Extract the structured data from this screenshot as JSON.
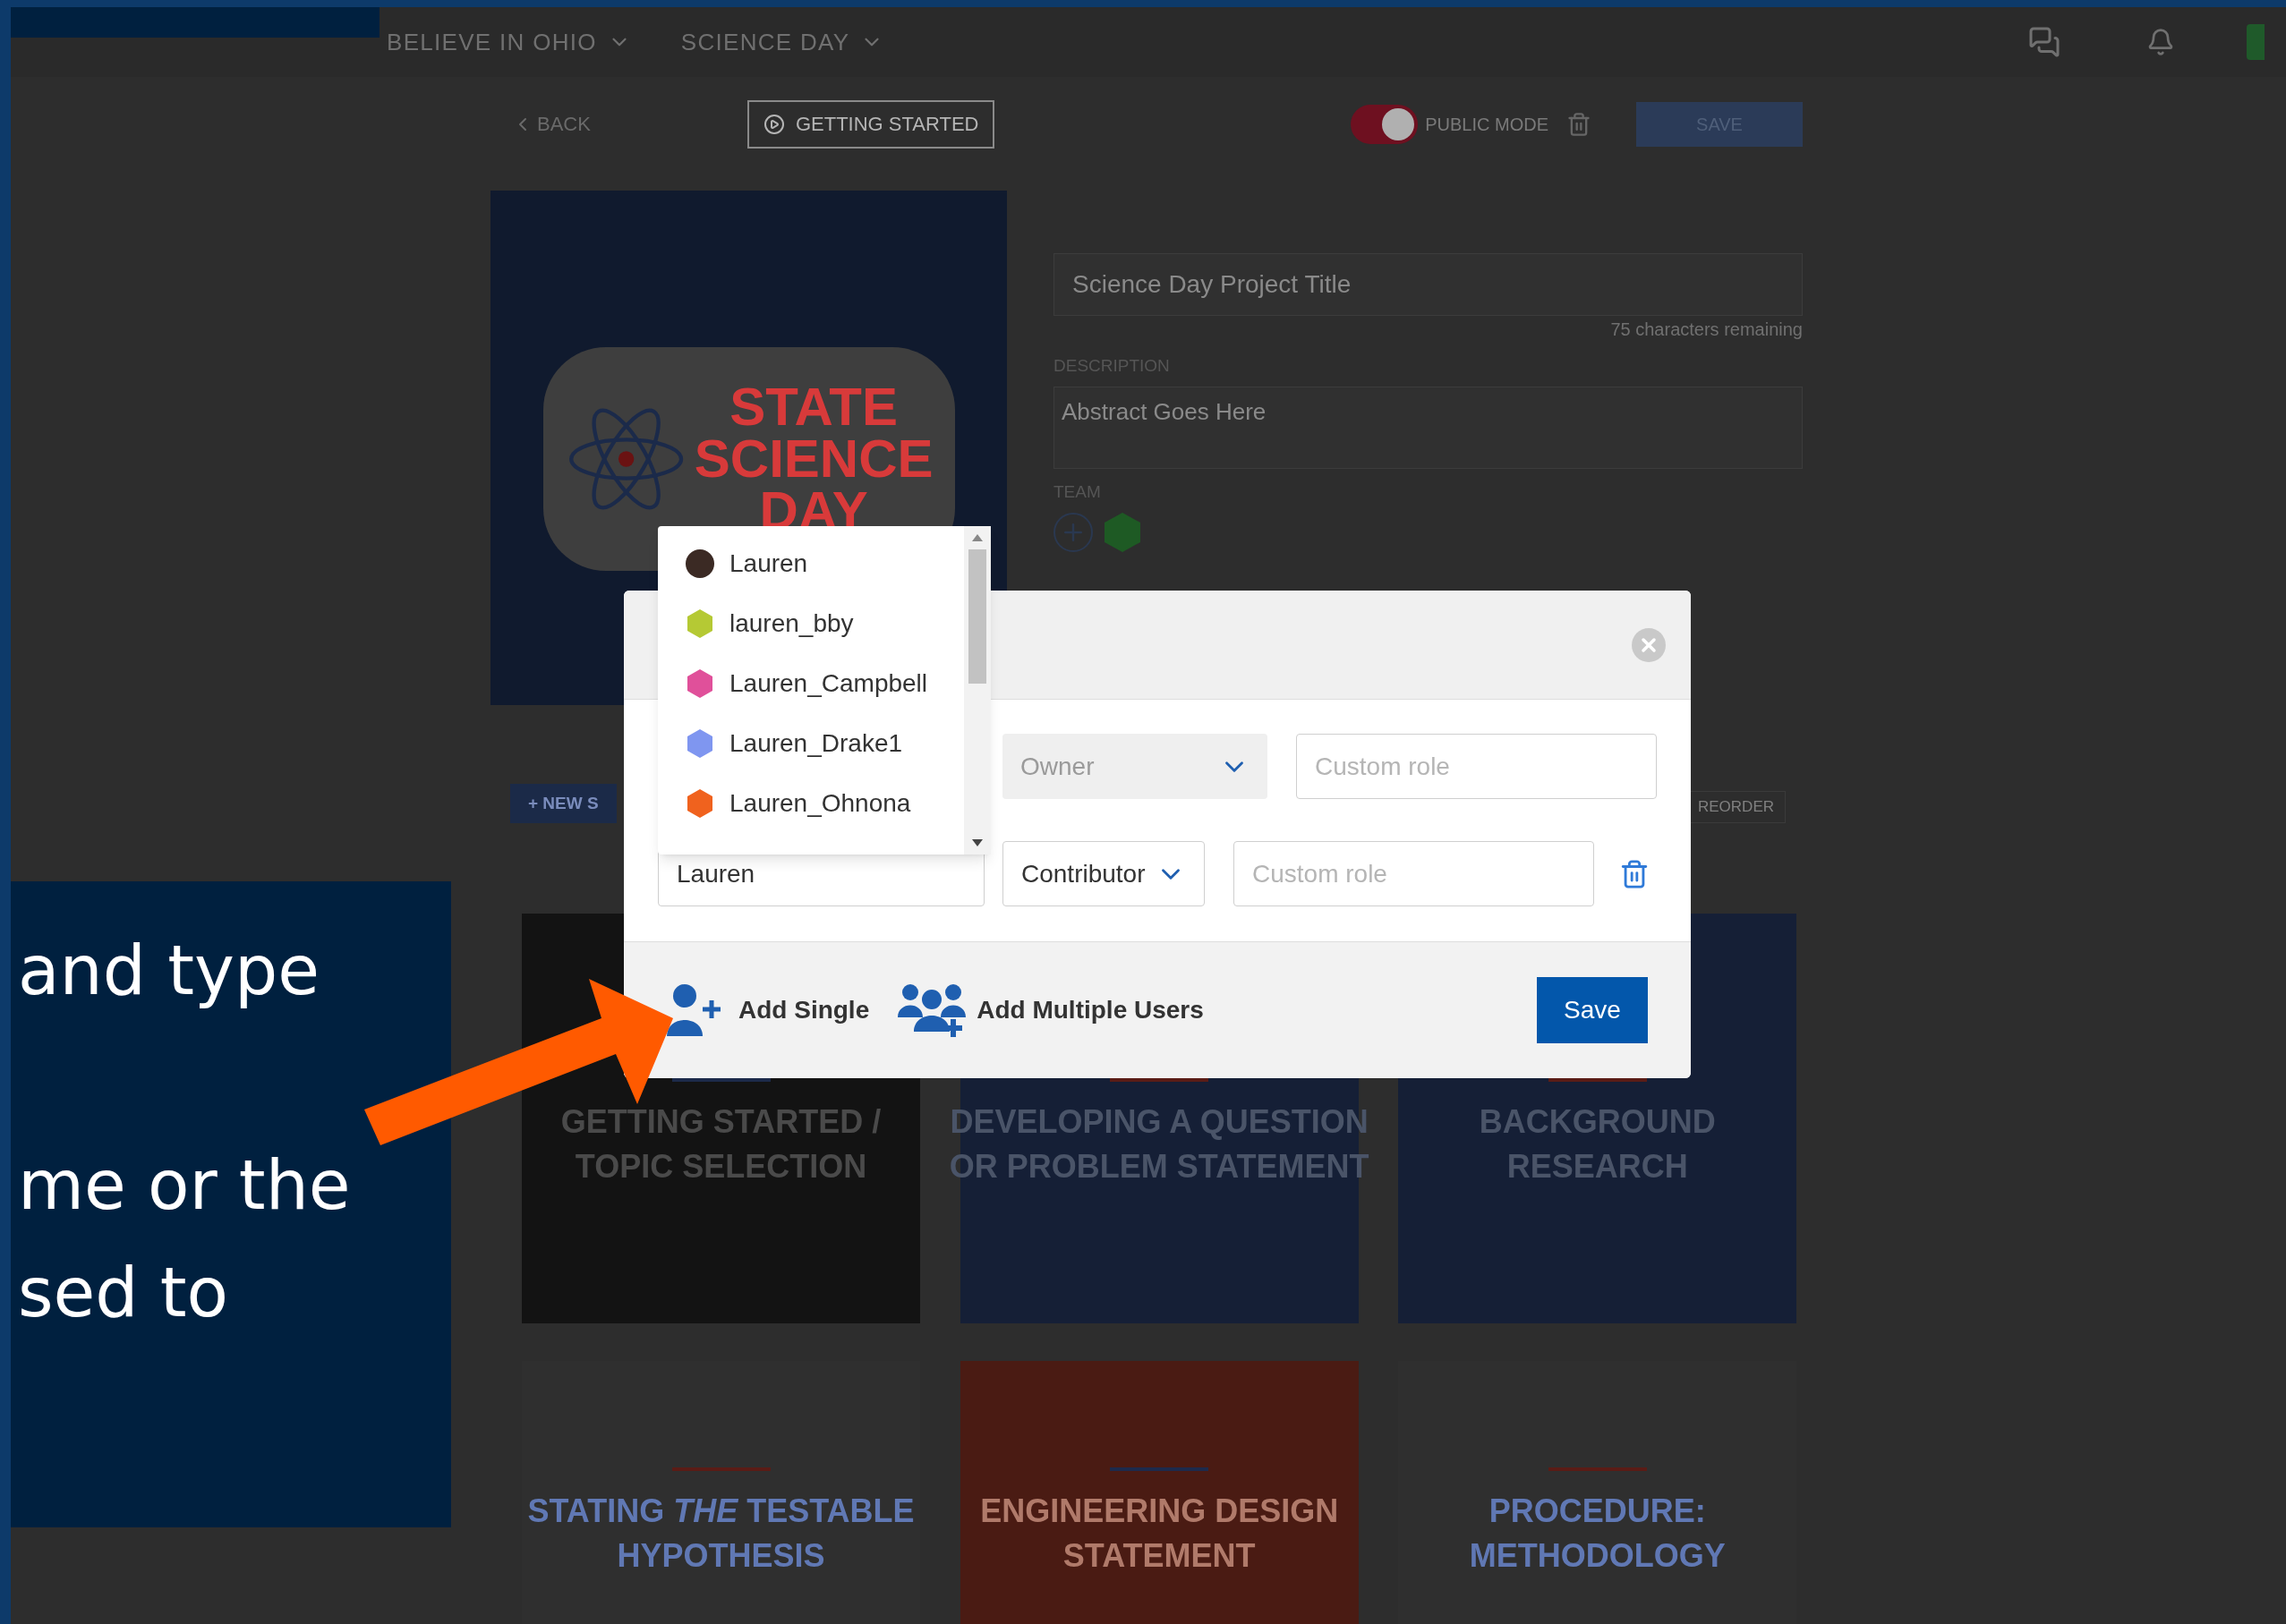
{
  "nav": {
    "items": [
      {
        "label": "BELIEVE IN OHIO"
      },
      {
        "label": "SCIENCE DAY"
      }
    ]
  },
  "toolbar": {
    "back": "BACK",
    "getting_started": "GETTING STARTED",
    "public_mode": {
      "label": "PUBLIC MODE",
      "on": true
    },
    "save": "SAVE"
  },
  "project": {
    "logo_lines": [
      "STATE",
      "SCIENCE",
      "DAY"
    ],
    "title": {
      "value": "Science Day Project Title",
      "counter": "75 characters remaining"
    },
    "description": {
      "label": "DESCRIPTION",
      "value": "Abstract Goes Here"
    },
    "team": {
      "label": "TEAM"
    }
  },
  "actions": {
    "new": "+ NEW S",
    "reorder": "REORDER"
  },
  "cards": [
    {
      "title": "GETTING STARTED /",
      "subtitle": "TOPIC SELECTION",
      "kind": "dark"
    },
    {
      "title": "DEVELOPING A QUESTION",
      "subtitle": "OR PROBLEM STATEMENT",
      "kind": "navy"
    },
    {
      "title": "BACKGROUND",
      "subtitle": "RESEARCH",
      "kind": "navy"
    },
    {
      "title": "STATING *THE* TESTABLE",
      "subtitle": "HYPOTHESIS",
      "kind": "light"
    },
    {
      "title": "ENGINEERING DESIGN",
      "subtitle": "STATEMENT",
      "kind": "red"
    },
    {
      "title": "PROCEDURE:",
      "subtitle": "METHODOLOGY",
      "kind": "light"
    }
  ],
  "modal": {
    "rows": [
      {
        "role": "Owner",
        "disabled": true,
        "custom_role_placeholder": "Custom role",
        "deletable": false
      },
      {
        "user": "Lauren",
        "role": "Contributor",
        "disabled": false,
        "custom_role_placeholder": "Custom role",
        "deletable": true
      }
    ],
    "add_single": "Add Single",
    "add_multiple": "Add Multiple Users",
    "save": "Save"
  },
  "suggestions": [
    {
      "name": "Lauren",
      "color": "#3b2a24"
    },
    {
      "name": "lauren_bby",
      "color": "#b5c934"
    },
    {
      "name": "Lauren_Campbell",
      "color": "#e0509a"
    },
    {
      "name": "Lauren_Drake1",
      "color": "#7f96f0"
    },
    {
      "name": "Lauren_Ohnona",
      "color": "#f0621e"
    }
  ],
  "callout": {
    "paragraphs": [
      [
        "and type"
      ],
      [
        "me or the",
        "sed to"
      ]
    ]
  }
}
